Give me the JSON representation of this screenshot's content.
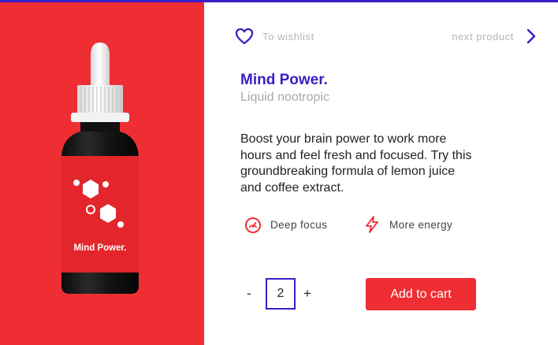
{
  "product": {
    "bottle_label": "Mind Power.",
    "title": "Mind Power.",
    "subtitle": "Liquid nootropic",
    "description": "Boost your brain power to work more hours and feel fresh and focused. Try this groundbreaking formula of lemon juice and coffee extract."
  },
  "nav": {
    "wishlist_label": "To wishlist",
    "next_label": "next product",
    "wishlist_icon": "heart-icon",
    "next_icon": "chevron-right-icon"
  },
  "features": [
    {
      "label": "Deep focus",
      "icon": "gauge-icon"
    },
    {
      "label": "More energy",
      "icon": "lightning-icon"
    }
  ],
  "cart": {
    "minus_label": "-",
    "quantity": "2",
    "plus_label": "+",
    "add_label": "Add to cart"
  },
  "colors": {
    "accent": "#3a1fc4",
    "brand_red": "#ee2e33",
    "muted_text": "#b5b5b5"
  }
}
